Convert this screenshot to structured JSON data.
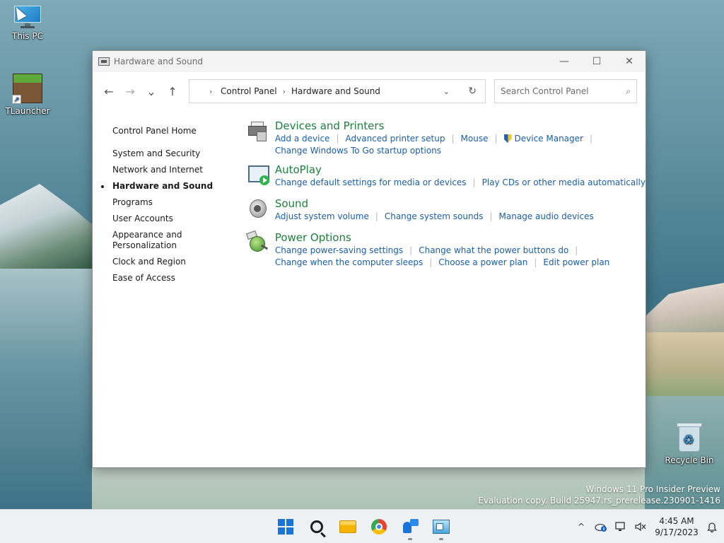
{
  "desktop": {
    "icons": [
      {
        "label": "This PC"
      },
      {
        "label": "TLauncher"
      },
      {
        "label": "Recycle Bin"
      }
    ],
    "watermark": {
      "line1": "Windows 11 Pro Insider Preview",
      "line2": "Evaluation copy. Build 25947.rs_prerelease.230901-1416"
    }
  },
  "window": {
    "title": "Hardware and Sound",
    "controls": {
      "minimize": "—",
      "maximize": "☐",
      "close": "✕"
    },
    "nav": {
      "back": "←",
      "forward": "→",
      "recent": "⌄",
      "up": "↑"
    },
    "address": {
      "lead_chevron": "›",
      "crumbs": [
        "Control Panel",
        "Hardware and Sound"
      ],
      "separator": "›",
      "dropdown": "⌄",
      "refresh": "↻"
    },
    "search": {
      "placeholder": "Search Control Panel",
      "value": "",
      "icon": "⌕"
    },
    "leftnav": {
      "home": "Control Panel Home",
      "items": [
        {
          "label": "System and Security"
        },
        {
          "label": "Network and Internet"
        },
        {
          "label": "Hardware and Sound"
        },
        {
          "label": "Programs"
        },
        {
          "label": "User Accounts"
        },
        {
          "label": "Appearance and Personalization"
        },
        {
          "label": "Clock and Region"
        },
        {
          "label": "Ease of Access"
        }
      ],
      "active_index": 2
    },
    "categories": [
      {
        "title": "Devices and Printers",
        "icon": "printer-icon",
        "links": [
          "Add a device",
          "Advanced printer setup",
          "Mouse",
          "Device Manager",
          "Change Windows To Go startup options"
        ]
      },
      {
        "title": "AutoPlay",
        "icon": "autoplay-icon",
        "links": [
          "Change default settings for media or devices",
          "Play CDs or other media automatically"
        ]
      },
      {
        "title": "Sound",
        "icon": "speaker-icon",
        "links": [
          "Adjust system volume",
          "Change system sounds",
          "Manage audio devices"
        ]
      },
      {
        "title": "Power Options",
        "icon": "power-plan-icon",
        "links": [
          "Change power-saving settings",
          "Change what the power buttons do",
          "Change when the computer sleeps",
          "Choose a power plan",
          "Edit power plan"
        ]
      }
    ]
  },
  "taskbar": {
    "apps": [
      "start-icon",
      "search-icon",
      "file-explorer-icon",
      "chrome-icon",
      "teams-icon",
      "control-panel-icon"
    ],
    "tray": {
      "overflow": "^",
      "clock_time": "4:45 AM",
      "clock_date": "9/17/2023",
      "notification": "🔔"
    }
  }
}
